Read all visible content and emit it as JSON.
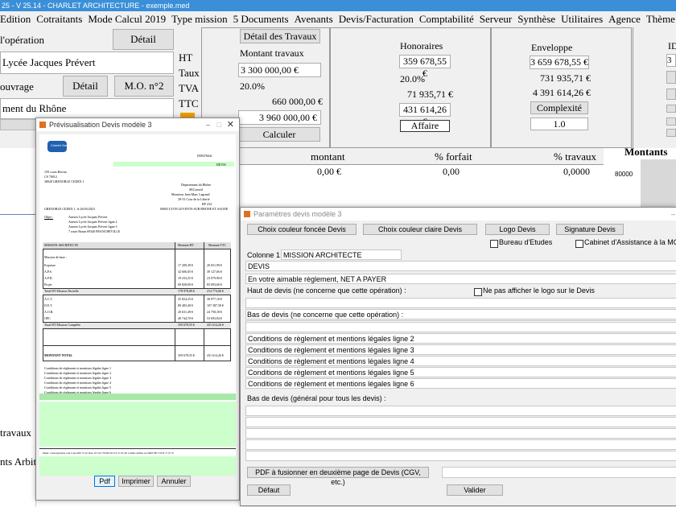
{
  "app": {
    "title": "25 - V 25.14 - CHARLET ARCHITECTURE - exemple.med"
  },
  "menu": [
    "Edition",
    "Cotraitants",
    "Mode Calcul 2019",
    "Type mission",
    "5 Documents",
    "Avenants",
    "Devis/Facturation",
    "Comptabilité",
    "Serveur",
    "Synthèse",
    "Utilitaires",
    "Agence",
    "Thème",
    "?"
  ],
  "left": {
    "operation_label": "l'opération",
    "detail_btn": "Détail",
    "operation_value": "Lycée Jacques Prévert",
    "ouvrage_label": "ouvrage",
    "detail2_btn": "Détail",
    "mo_btn": "M.O. n°2",
    "ment_value": "ment du Rhône",
    "travaux_label": "travaux",
    "arbitr_label": "nts Arbitr"
  },
  "center": {
    "labels": [
      "HT",
      "Taux",
      "TVA",
      "TTC"
    ],
    "detail_travaux_btn": "Détail des Travaux",
    "montant_travaux_label": "Montant travaux",
    "montant_value": "3 300 000,00 €",
    "taux_value": "20.0%",
    "tva_value": "660 000,00 €",
    "ttc_value": "3 960 000,00 €",
    "calculer_btn": "Calculer"
  },
  "honoraires": {
    "title": "Honoraires",
    "ht": "359 678,55 €",
    "taux": "20.0%",
    "tva": "71 935,71 €",
    "ttc": "431 614,26 €",
    "affaire_btn": "Affaire"
  },
  "enveloppe": {
    "title": "Enveloppe",
    "ht": "3 659 678,55 €",
    "tva": "731 935,71 €",
    "ttc": "4 391 614,26 €",
    "complexite_btn": "Complexité",
    "complexite_value": "1.0"
  },
  "right_edge": {
    "id_label": "ID",
    "val": "3"
  },
  "table": {
    "headers": [
      "montant",
      "% forfait",
      "% travaux"
    ],
    "row1": [
      "0,00 €",
      "0,00",
      "0,0000"
    ],
    "montants_title": "Montants",
    "axis_value": "80000"
  },
  "preview": {
    "title": "Prévisualisation Devis modèle 3",
    "logo_text": "Charlet Sarl",
    "ref": "DEVIS",
    "devis_num": "D09476641",
    "addr_lines": [
      "159 cours Berriat",
      "CS 70012",
      "38028 GRENOBLE CEDEX 1"
    ],
    "client_lines": [
      "Département du Rhône",
      "SEConseil",
      "Monsieur Jean-Marc Lagrand",
      "29-31 Cour de la Liberté",
      "BP 234",
      "69003 LYON LEVENTS SUR RHONE ET SAONE"
    ],
    "date_line": "GRENOBLE CEDEX 1, le 26/03/2023",
    "objet_label": "Objet :",
    "objet_lines": [
      "Anexes Lycée Jacques Prévert",
      "Anexes Lycée Jacques Prévert ligne 2",
      "Anexes Lycée Jacques Prévert ligne 3",
      "7 route Braun 69340 FRANCHEVILLE"
    ],
    "table_headers": [
      "MISSION ARCHITECTE",
      "Montant HT",
      "Montant TTC"
    ],
    "table_rows": [
      [
        "Mission de base :",
        "",
        ""
      ],
      [
        "Esquisse",
        "17 209,39 €",
        "20 651,99 €"
      ],
      [
        "A.P.S.",
        "32 606,05 €",
        "39 127,06 €"
      ],
      [
        "A.P.D.",
        "19 233,25 €",
        "23 079,90 €"
      ],
      [
        "Projet",
        "69 828,00 €",
        "83 693,60 €"
      ],
      [
        "Total HT Mission Partielle",
        "178 978,89 €",
        "214 774,66 €"
      ],
      [
        "A.C.T.",
        "25 824,25 €",
        "30 977,10 €"
      ],
      [
        "D.E.T.",
        "89 483,49 €",
        "107 387,58 €"
      ],
      [
        "A.O.R.",
        "20 631,49 €",
        "24 758,18 €"
      ],
      [
        "OPC",
        "40 744,70 €",
        "53 693,84 €"
      ],
      [
        "Total HT Mission Complète",
        "359 678,55 €",
        "431 614,26 €"
      ]
    ],
    "total_label": "MONTANT TOTAL",
    "total_ht": "359 678,55 €",
    "total_ttc": "431 614,26 €",
    "conditions": [
      "Conditions de règlement et mentions légales ligne 1",
      "Conditions de règlement et mentions légales ligne 2",
      "Conditions de règlement et mentions légales ligne 3",
      "Conditions de règlement et mentions légales ligne 4",
      "Conditions de règlement et mentions légales ligne 5",
      "Conditions de règlement et mentions légales ligne 6"
    ],
    "footer": "Email: contact@charlet.com  Code APE 7111Z  Siret: 03 154 778 000 40  CCI: 47-45 ZE Comme chiffres sur SRET BF 3 STIT 17 07 70",
    "btn_pdf": "Pdf",
    "btn_print": "Imprimer",
    "btn_cancel": "Annuler"
  },
  "params": {
    "title": "Paramètres devis modèle 3",
    "btn_foncee": "Choix couleur foncée Devis",
    "btn_claire": "Choix couleur claire Devis",
    "btn_logo": "Logo Devis",
    "btn_signature": "Signature Devis",
    "chk_bureau": "Bureau d'Etudes",
    "chk_cabinet": "Cabinet d'Assistance à la MO",
    "colonne_label": "Colonne 1 :",
    "colonne_value": "MISSION ARCHITECTE",
    "devis_value": "DEVIS",
    "aimable_value": "En votre aimable règlement, NET A PAYER",
    "haut_label": "Haut de devis (ne concerne que cette opération) :",
    "no_logo_label": "Ne pas afficher le logo sur le Devis",
    "bas_label": "Bas de devis  (ne concerne que cette opération) :",
    "bas_lines": [
      "Conditions de règlement et mentions légales ligne 2",
      "Conditions de règlement et mentions légales ligne 3",
      "Conditions de règlement et mentions légales ligne 4",
      "Conditions de règlement et mentions légales ligne 5",
      "Conditions de règlement et mentions légales ligne 6"
    ],
    "bas_general_label": "Bas de devis  (général pour tous les devis) :",
    "btn_pdf_fusion": "PDF à fusionner en deuxième page de Devis (CGV, etc.)",
    "btn_defaut": "Défaut",
    "btn_valider": "Valider"
  },
  "colors": {
    "green": "#ccffcc",
    "title_blue": "#3a8fd8"
  }
}
